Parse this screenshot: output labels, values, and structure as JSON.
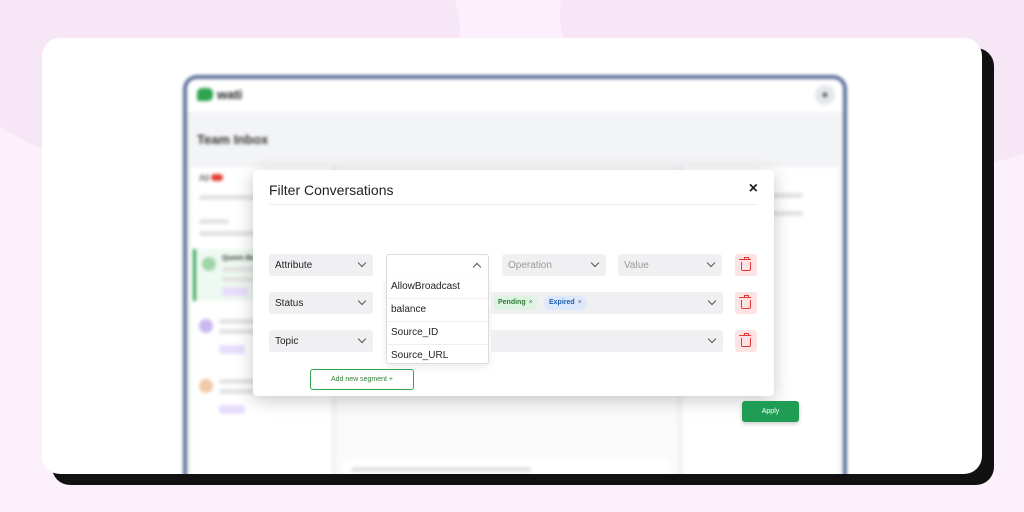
{
  "app": {
    "logo_text": "wati",
    "page_title": "Team Inbox",
    "tab_all": "All",
    "active_conversation_name": "Queen Bee"
  },
  "modal": {
    "title": "Filter Conversations",
    "close_label": "×",
    "rows": [
      {
        "field": "Attribute",
        "operation": "Operation",
        "value": "Value"
      },
      {
        "field": "Status",
        "tags": [
          "Pending",
          "Expired"
        ]
      },
      {
        "field": "Topic"
      }
    ],
    "dropdown_options": [
      "AllowBroadcast",
      "balance",
      "Source_ID",
      "Source_URL"
    ],
    "add_segment_label": "Add new segment +",
    "apply_label": "Apply"
  },
  "colors": {
    "accent_green": "#2ea44f",
    "delete_red": "#e53935"
  }
}
